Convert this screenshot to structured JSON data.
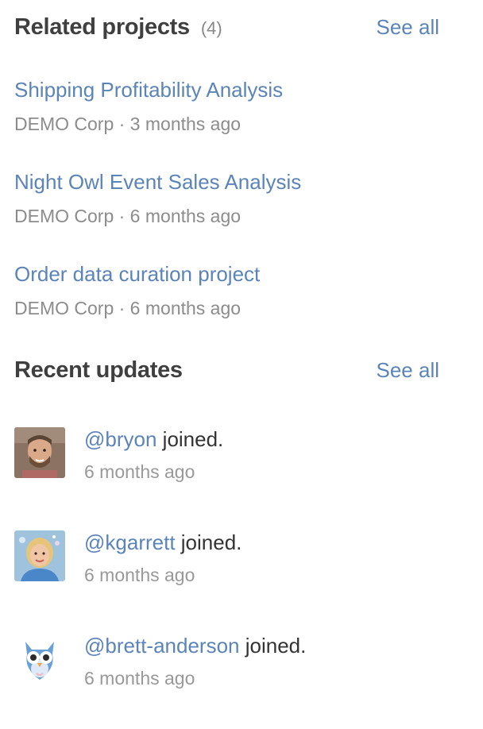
{
  "related": {
    "title": "Related projects",
    "count": "(4)",
    "see_all": "See all",
    "projects": [
      {
        "title": "Shipping Profitability Analysis",
        "meta": "DEMO Corp · 3 months ago"
      },
      {
        "title": "Night Owl Event Sales Analysis",
        "meta": "DEMO Corp · 6 months ago"
      },
      {
        "title": "Order data curation project",
        "meta": "DEMO Corp · 6 months ago"
      }
    ]
  },
  "updates": {
    "title": "Recent updates",
    "see_all": "See all",
    "items": [
      {
        "user": "@bryon",
        "action": " joined.",
        "time": "6 months ago",
        "avatar": "photo-man"
      },
      {
        "user": "@kgarrett",
        "action": " joined.",
        "time": "6 months ago",
        "avatar": "photo-woman"
      },
      {
        "user": "@brett-anderson",
        "action": " joined.",
        "time": "6 months ago",
        "avatar": "owl-icon"
      }
    ]
  },
  "colors": {
    "link": "#5b84b8",
    "heading": "#3f3f3f",
    "muted": "#8c8c8c"
  }
}
